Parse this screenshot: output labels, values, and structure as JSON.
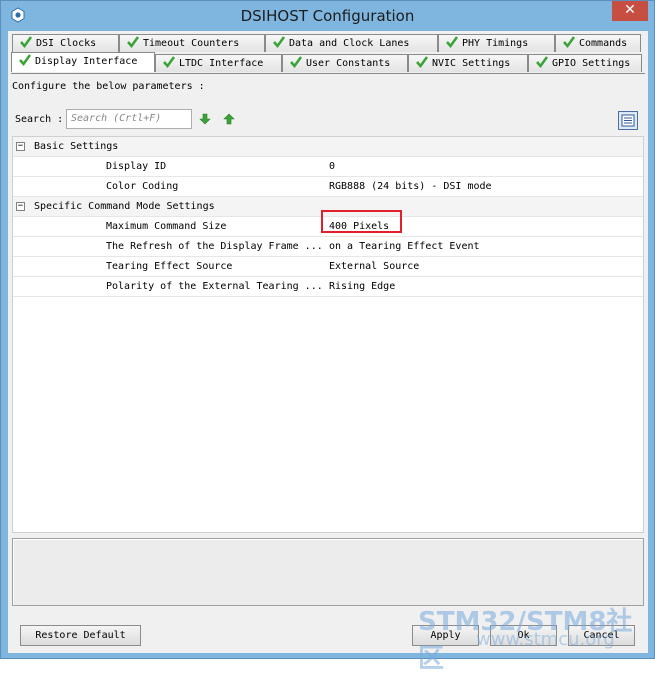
{
  "window": {
    "title": "DSIHOST Configuration",
    "close_glyph": "✕"
  },
  "tabs_row1": [
    {
      "label": "DSI Clocks"
    },
    {
      "label": "Timeout Counters"
    },
    {
      "label": "Data and Clock Lanes"
    },
    {
      "label": "PHY Timings"
    },
    {
      "label": "Commands"
    }
  ],
  "tabs_row2": [
    {
      "label": "Display Interface",
      "active": true
    },
    {
      "label": "LTDC Interface"
    },
    {
      "label": "User Constants"
    },
    {
      "label": "NVIC Settings"
    },
    {
      "label": "GPIO Settings"
    }
  ],
  "instruction": "Configure the below parameters :",
  "search": {
    "label": "Search :",
    "placeholder": "Search (Crtl+F)"
  },
  "groups": [
    {
      "name": "Basic Settings",
      "toggle": "−",
      "params": [
        {
          "name": "Display ID",
          "value": "0"
        },
        {
          "name": "Color Coding",
          "value": "RGB888 (24 bits) - DSI mode"
        }
      ]
    },
    {
      "name": "Specific Command Mode Settings",
      "toggle": "−",
      "params": [
        {
          "name": "Maximum Command Size",
          "value": "400 Pixels"
        },
        {
          "name": "The Refresh of the Display Frame ...",
          "value": "on a Tearing Effect Event"
        },
        {
          "name": "Tearing Effect Source",
          "value": "External Source"
        },
        {
          "name": "Polarity of the External Tearing ...",
          "value": "Rising Edge"
        }
      ]
    }
  ],
  "buttons": {
    "restore": "Restore Default",
    "apply": "Apply",
    "ok": "Ok",
    "cancel": "Cancel"
  },
  "watermark": {
    "brand": "STM32/STM8社区",
    "url": "www.stmcu.org"
  },
  "colors": {
    "titlebar": "#7fb6df",
    "close": "#c74f41",
    "check": "#3aa335",
    "arrow": "#3aa335",
    "highlight": "#e0202a"
  }
}
